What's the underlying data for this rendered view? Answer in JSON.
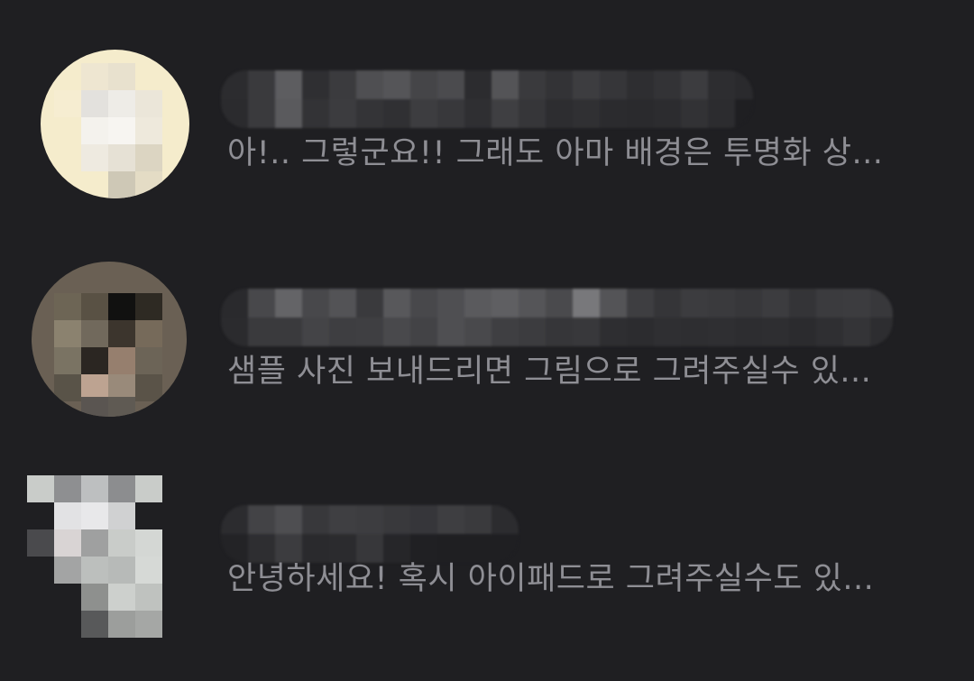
{
  "conversations": [
    {
      "preview": "아!.. 그렇군요!! 그래도 아마 배경은 투명화 상..."
    },
    {
      "preview": "샘플 사진 보내드리면 그림으로 그려주실수 있..."
    },
    {
      "preview": "안녕하세요! 혹시 아이패드로 그려주실수도 있..."
    }
  ]
}
